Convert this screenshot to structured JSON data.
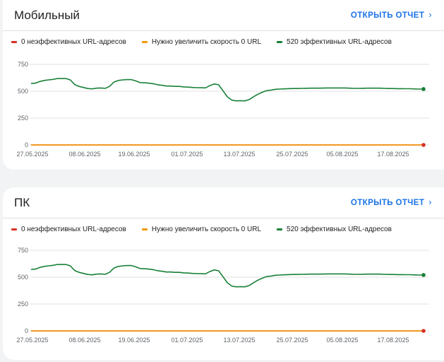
{
  "header_label": "ОТКРЫТЬ ОТЧЕТ",
  "legend": [
    {
      "label": "0 неэффективных URL-адресов",
      "color": "#d93025"
    },
    {
      "label": "Нужно увеличить скорость 0 URL",
      "color": "#f29900"
    },
    {
      "label": "520 эффективных URL-адресов",
      "color": "#188038"
    }
  ],
  "cards": [
    {
      "title": "Мобильный",
      "open_report": "ОТКРЫТЬ ОТЧЕТ"
    },
    {
      "title": "ПК",
      "open_report": "ОТКРЫТЬ ОТЧЕТ"
    }
  ],
  "chart_data": [
    {
      "type": "line",
      "title": "Мобильный",
      "ylim": [
        0,
        750
      ],
      "yticks": [
        "750",
        "500",
        "250",
        "0"
      ],
      "xticks": [
        "27.05.2025",
        "08.06.2025",
        "19.06.2025",
        "01.07.2025",
        "13.07.2025",
        "25.07.2025",
        "05.08.2025",
        "17.08.2025"
      ],
      "grid": true,
      "legend_position": "top",
      "series": [
        {
          "name": "0 неэффективных URL-адресов",
          "color": "#d93025",
          "values": [
            0,
            0,
            0,
            0,
            0,
            0,
            0,
            0,
            0,
            0,
            0,
            0,
            0,
            0,
            0,
            0,
            0,
            0,
            0,
            0,
            0,
            0,
            0,
            0,
            0,
            0,
            0,
            0,
            0,
            0,
            0,
            0,
            0,
            0,
            0,
            0,
            0,
            0,
            0,
            0,
            0,
            0,
            0,
            0,
            0,
            0,
            0,
            0,
            0,
            0,
            0,
            0,
            0,
            0,
            0,
            0,
            0,
            0,
            0,
            0,
            0,
            0,
            0,
            0,
            0,
            0,
            0,
            0,
            0,
            0,
            0,
            0,
            0,
            0,
            0,
            0,
            0,
            0,
            0,
            0,
            0,
            0,
            0,
            0,
            0,
            0,
            0,
            0,
            0,
            0,
            0
          ]
        },
        {
          "name": "Нужно увеличить скорость 0 URL",
          "color": "#f29900",
          "values": [
            0,
            0,
            0,
            0,
            0,
            0,
            0,
            0,
            0,
            0,
            0,
            0,
            0,
            0,
            0,
            0,
            0,
            0,
            0,
            0,
            0,
            0,
            0,
            0,
            0,
            0,
            0,
            0,
            0,
            0,
            0,
            0,
            0,
            0,
            0,
            0,
            0,
            0,
            0,
            0,
            0,
            0,
            0,
            0,
            0,
            0,
            0,
            0,
            0,
            0,
            0,
            0,
            0,
            0,
            0,
            0,
            0,
            0,
            0,
            0,
            0,
            0,
            0,
            0,
            0,
            0,
            0,
            0,
            0,
            0,
            0,
            0,
            0,
            0,
            0,
            0,
            0,
            0,
            0,
            0,
            0,
            0,
            0,
            0,
            0,
            0,
            0,
            0,
            0,
            0,
            0
          ]
        },
        {
          "name": "520 эффективных URL-адресов",
          "color": "#188038",
          "values": [
            572,
            575,
            590,
            600,
            605,
            610,
            618,
            618,
            618,
            605,
            562,
            545,
            535,
            525,
            522,
            528,
            530,
            526,
            545,
            585,
            600,
            605,
            608,
            608,
            596,
            580,
            578,
            575,
            570,
            560,
            555,
            548,
            548,
            545,
            545,
            540,
            538,
            535,
            533,
            532,
            531,
            552,
            568,
            560,
            505,
            448,
            418,
            410,
            412,
            410,
            422,
            448,
            472,
            490,
            505,
            510,
            518,
            520,
            522,
            524,
            525,
            525,
            526,
            527,
            528,
            528,
            528,
            529,
            530,
            530,
            530,
            530,
            530,
            528,
            526,
            526,
            527,
            528,
            528,
            528,
            528,
            526,
            525,
            525,
            524,
            524,
            523,
            523,
            521,
            520,
            520
          ]
        }
      ]
    },
    {
      "type": "line",
      "title": "ПК",
      "ylim": [
        0,
        750
      ],
      "yticks": [
        "750",
        "500",
        "250",
        "0"
      ],
      "xticks": [
        "27.05.2025",
        "08.06.2025",
        "19.06.2025",
        "01.07.2025",
        "13.07.2025",
        "25.07.2025",
        "05.08.2025",
        "17.08.2025"
      ],
      "grid": true,
      "legend_position": "top",
      "series": [
        {
          "name": "0 неэффективных URL-адресов",
          "color": "#d93025",
          "values": [
            0,
            0,
            0,
            0,
            0,
            0,
            0,
            0,
            0,
            0,
            0,
            0,
            0,
            0,
            0,
            0,
            0,
            0,
            0,
            0,
            0,
            0,
            0,
            0,
            0,
            0,
            0,
            0,
            0,
            0,
            0,
            0,
            0,
            0,
            0,
            0,
            0,
            0,
            0,
            0,
            0,
            0,
            0,
            0,
            0,
            0,
            0,
            0,
            0,
            0,
            0,
            0,
            0,
            0,
            0,
            0,
            0,
            0,
            0,
            0,
            0,
            0,
            0,
            0,
            0,
            0,
            0,
            0,
            0,
            0,
            0,
            0,
            0,
            0,
            0,
            0,
            0,
            0,
            0,
            0,
            0,
            0,
            0,
            0,
            0,
            0,
            0,
            0,
            0,
            0,
            0
          ]
        },
        {
          "name": "Нужно увеличить скорость 0 URL",
          "color": "#f29900",
          "values": [
            0,
            0,
            0,
            0,
            0,
            0,
            0,
            0,
            0,
            0,
            0,
            0,
            0,
            0,
            0,
            0,
            0,
            0,
            0,
            0,
            0,
            0,
            0,
            0,
            0,
            0,
            0,
            0,
            0,
            0,
            0,
            0,
            0,
            0,
            0,
            0,
            0,
            0,
            0,
            0,
            0,
            0,
            0,
            0,
            0,
            0,
            0,
            0,
            0,
            0,
            0,
            0,
            0,
            0,
            0,
            0,
            0,
            0,
            0,
            0,
            0,
            0,
            0,
            0,
            0,
            0,
            0,
            0,
            0,
            0,
            0,
            0,
            0,
            0,
            0,
            0,
            0,
            0,
            0,
            0,
            0,
            0,
            0,
            0,
            0,
            0,
            0,
            0,
            0,
            0,
            0
          ]
        },
        {
          "name": "520 эффективных URL-адресов",
          "color": "#188038",
          "values": [
            572,
            575,
            590,
            600,
            605,
            610,
            618,
            618,
            618,
            605,
            562,
            545,
            535,
            525,
            522,
            528,
            530,
            526,
            545,
            585,
            600,
            605,
            608,
            608,
            596,
            580,
            578,
            575,
            570,
            560,
            555,
            548,
            548,
            545,
            545,
            540,
            538,
            535,
            533,
            532,
            531,
            552,
            568,
            560,
            505,
            448,
            418,
            410,
            412,
            410,
            422,
            448,
            472,
            490,
            505,
            510,
            518,
            520,
            522,
            524,
            525,
            525,
            526,
            527,
            528,
            528,
            528,
            529,
            530,
            530,
            530,
            530,
            530,
            528,
            526,
            526,
            527,
            528,
            528,
            528,
            528,
            526,
            525,
            525,
            524,
            524,
            523,
            523,
            521,
            520,
            520
          ]
        }
      ]
    }
  ]
}
